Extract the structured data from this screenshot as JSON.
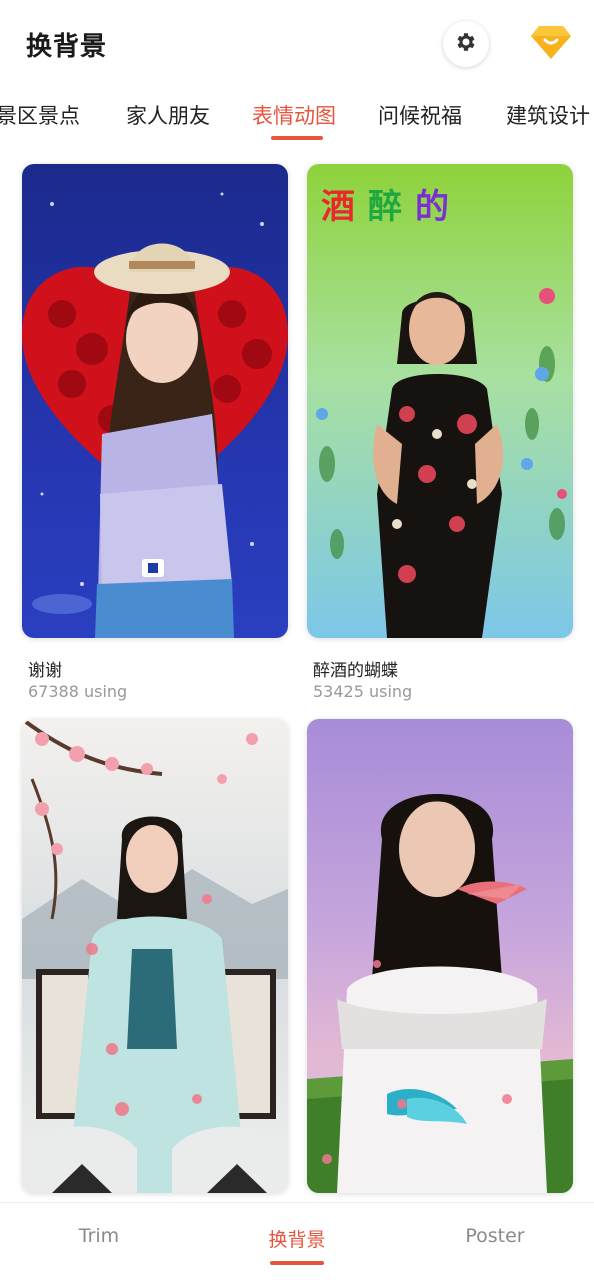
{
  "header": {
    "title": "换背景",
    "settings_icon": "gear-icon",
    "vip_icon": "diamond-icon",
    "accent_color": "#e8553f"
  },
  "tabs": [
    {
      "label": "景区景点",
      "active": false
    },
    {
      "label": "家人朋友",
      "active": false
    },
    {
      "label": "表情动图",
      "active": true
    },
    {
      "label": "问候祝福",
      "active": false
    },
    {
      "label": "建筑设计",
      "active": false
    }
  ],
  "templates": [
    {
      "title": "谢谢",
      "count": "67388 using",
      "overlay": ""
    },
    {
      "title": "醉酒的蝴蝶",
      "count": "53425 using",
      "overlay": "酒醉的"
    },
    {
      "title": "",
      "count": "",
      "overlay": ""
    },
    {
      "title": "",
      "count": "",
      "overlay": ""
    }
  ],
  "bottom_nav": [
    {
      "label": "Trim",
      "active": false
    },
    {
      "label": "换背景",
      "active": true
    },
    {
      "label": "Poster",
      "active": false
    }
  ]
}
